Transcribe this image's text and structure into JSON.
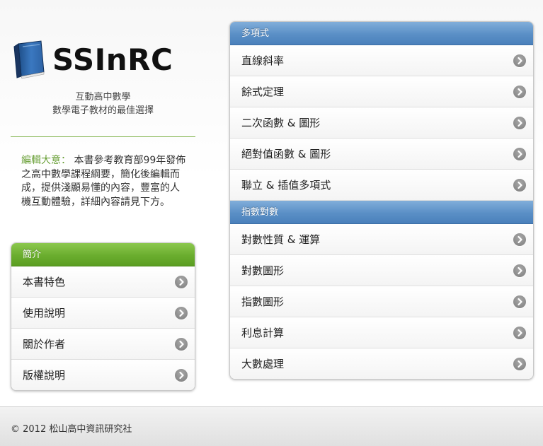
{
  "brand": {
    "name": "SSInRC",
    "tagline_line1": "互動高中數學",
    "tagline_line2": "數學電子教材的最佳選擇",
    "icon": "book-icon"
  },
  "intro": {
    "label": "編輯大意：",
    "text": "本書參考教育部99年發佈之高中數學課程綱要，簡化後編輯而成，提供淺顯易懂的內容，豐富的人機互動體驗，詳細內容請見下方。"
  },
  "about_panel": {
    "header": "簡介",
    "items": [
      {
        "label": "本書特色"
      },
      {
        "label": "使用說明"
      },
      {
        "label": "關於作者"
      },
      {
        "label": "版權說明"
      }
    ]
  },
  "polynomials_panel": {
    "header": "多項式",
    "items": [
      {
        "label": "直線斜率"
      },
      {
        "label": "餘式定理"
      },
      {
        "label": "二次函數 & 圖形"
      },
      {
        "label": "絕對值函數 & 圖形"
      },
      {
        "label": "聯立 & 插值多項式"
      }
    ]
  },
  "logs_panel": {
    "header": "指數對數",
    "items": [
      {
        "label": "對數性質 & 運算"
      },
      {
        "label": "對數圖形"
      },
      {
        "label": "指數圖形"
      },
      {
        "label": "利息計算"
      },
      {
        "label": "大數處理"
      }
    ]
  },
  "footer": {
    "copyright": "© 2012 松山高中資訊研究社"
  },
  "colors": {
    "accent_blue": "#5a8fc6",
    "accent_green": "#6aad2e",
    "intro_label": "#6aa038"
  }
}
